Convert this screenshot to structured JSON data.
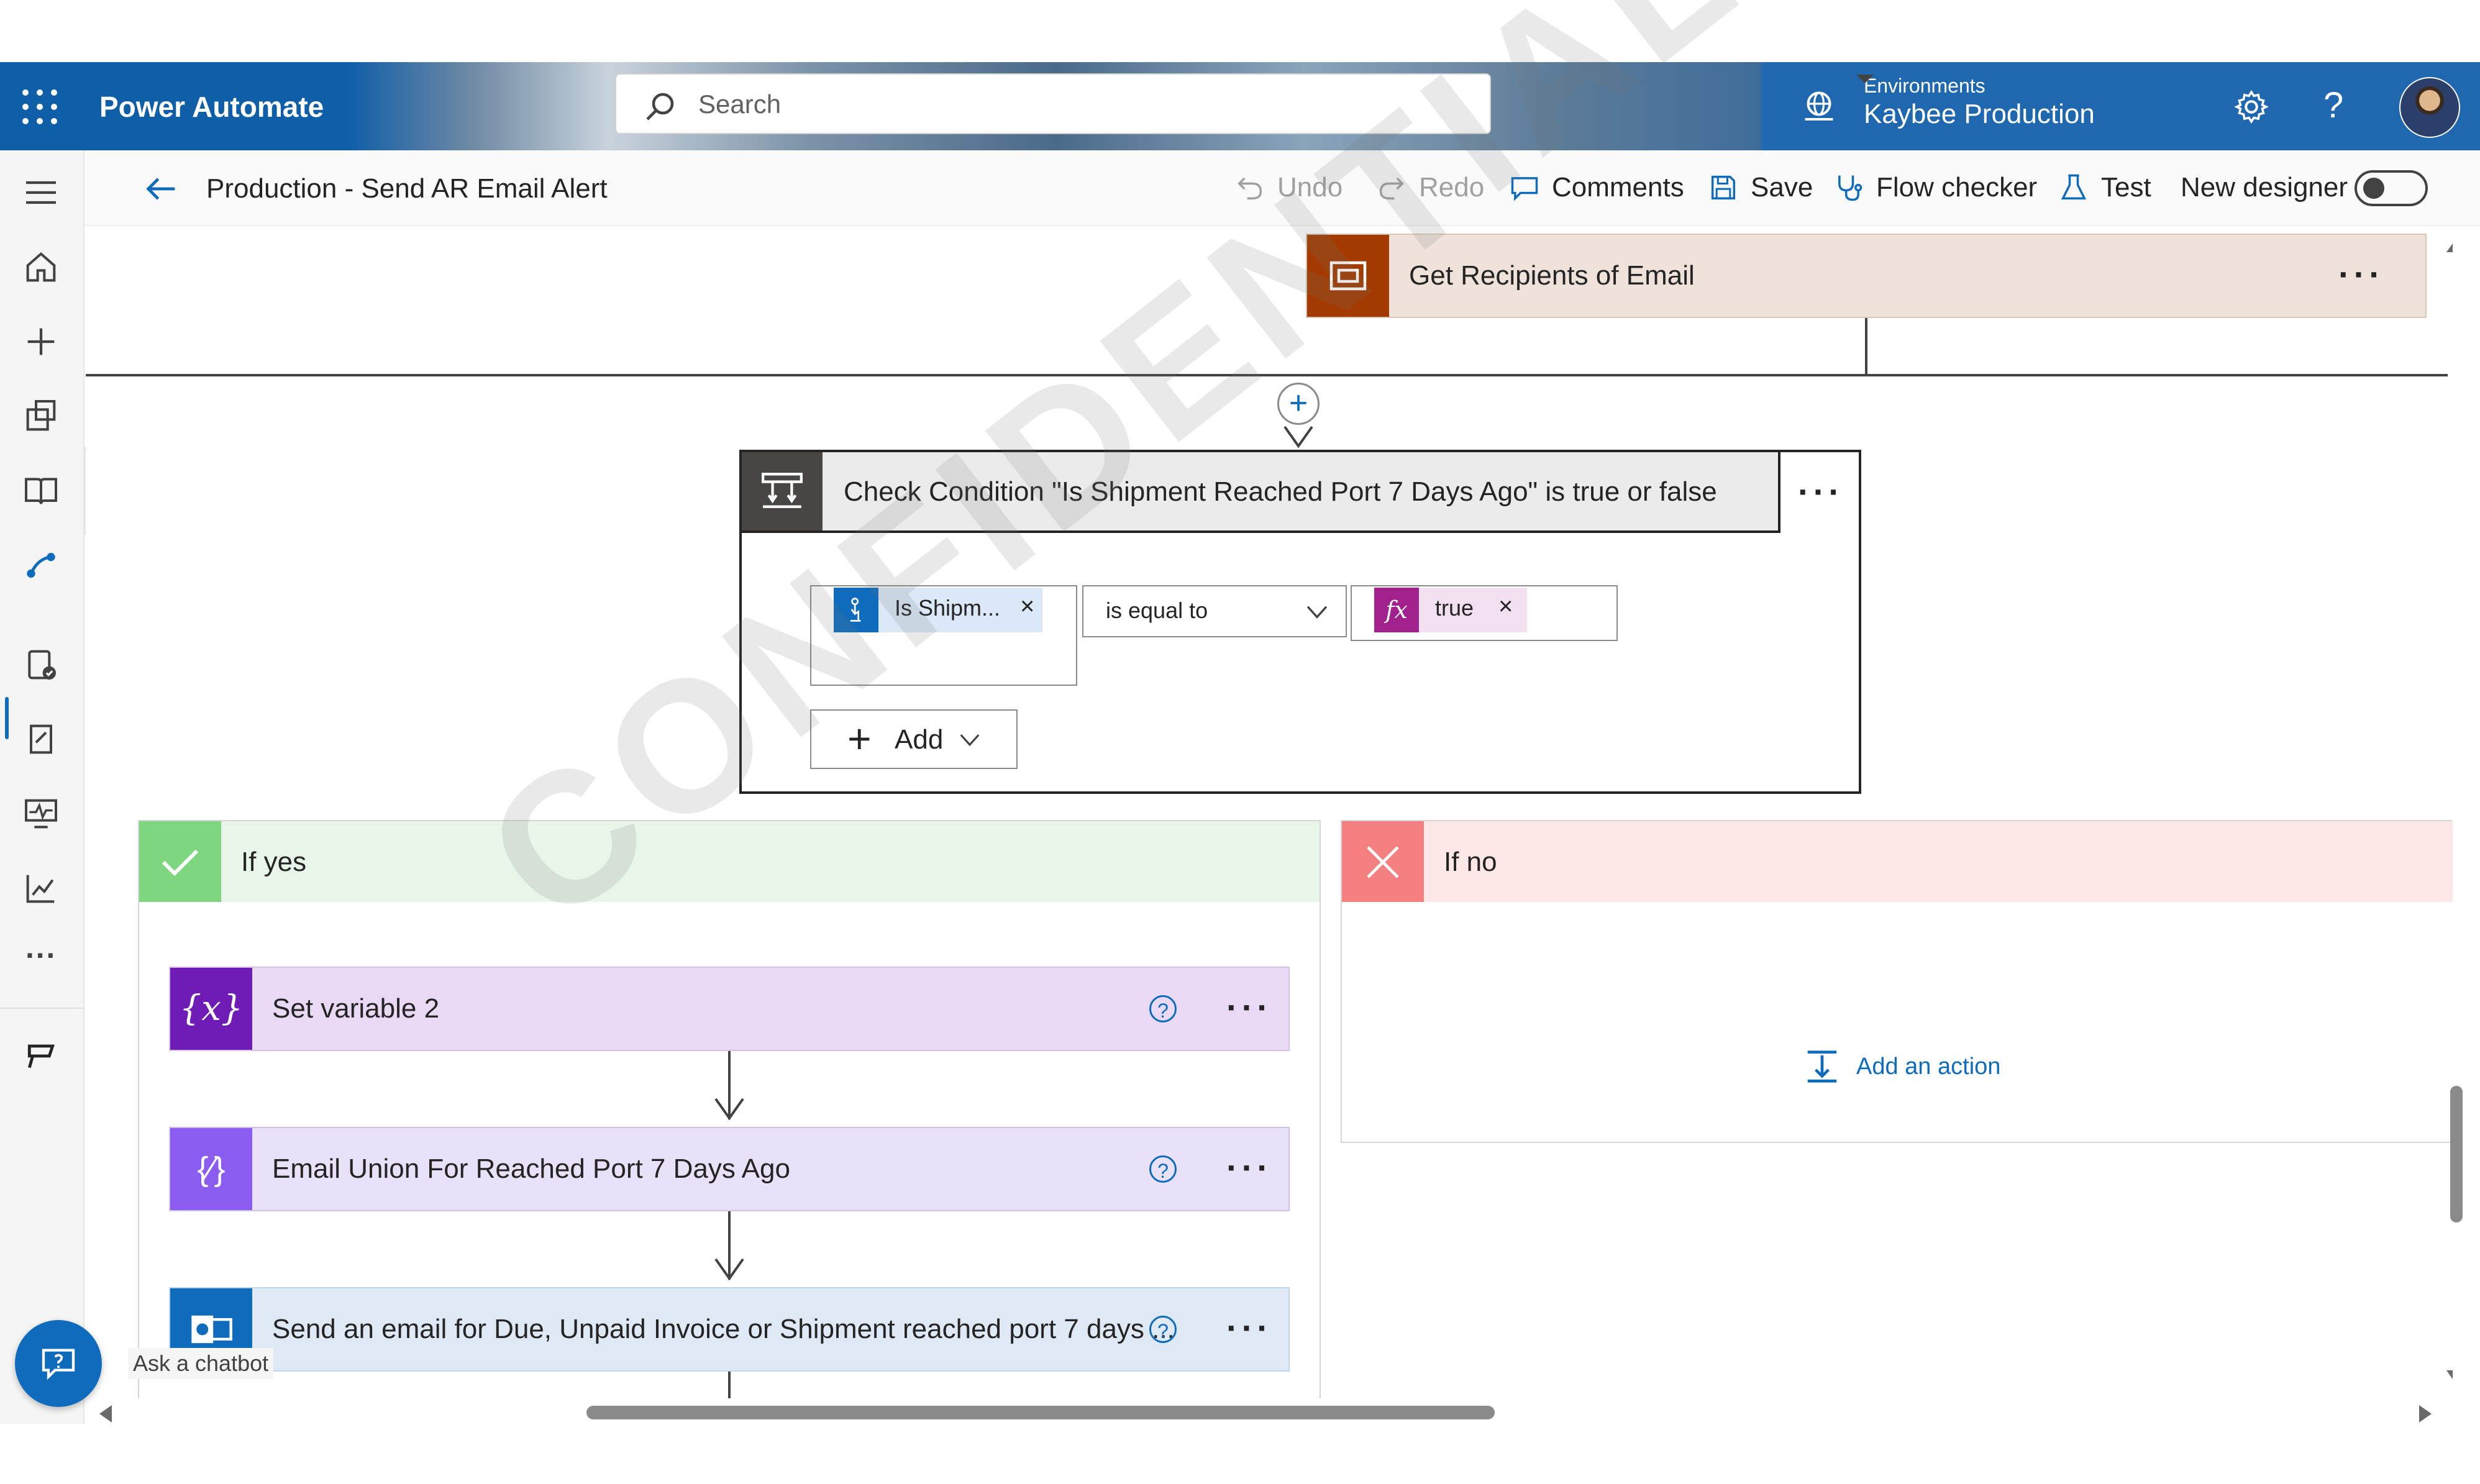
{
  "header": {
    "app_title": "Power Automate",
    "search_placeholder": "Search",
    "environments_label": "Environments",
    "environment_name": "Kaybee Production"
  },
  "command_bar": {
    "flow_name": "Production - Send AR Email Alert",
    "undo": "Undo",
    "redo": "Redo",
    "comments": "Comments",
    "save": "Save",
    "flow_checker": "Flow checker",
    "test": "Test",
    "new_designer": "New designer",
    "new_designer_on": false
  },
  "flow": {
    "get_recipients": "Get Recipients of Email",
    "condition_title": "Check Condition \"Is Shipment Reached Port 7 Days Ago\" is true or false",
    "condition_left_token": "Is Shipm...",
    "condition_operator": "is equal to",
    "condition_right_token": "true",
    "add_button": "Add",
    "if_yes_label": "If yes",
    "if_no_label": "If no",
    "yes_actions": [
      "Set variable 2",
      "Email Union For Reached Port 7 Days Ago",
      "Send an email for Due, Unpaid Invoice or Shipment reached port 7 days ..."
    ],
    "add_an_action": "Add an action"
  },
  "watermark": "CONFIDENTIAL",
  "chatbot_label": "Ask a chatbot",
  "colors": {
    "brand_blue": "#0f6cbd",
    "get_recipients_icon_bg": "#a33b00",
    "get_recipients_card_bg": "#efe2da",
    "condition_icon_bg": "#484644",
    "yes_header_bg": "#e8f5e9",
    "yes_icon_bg": "#7ed67e",
    "no_header_bg": "#fde7e7",
    "no_icon_bg": "#f47f7f",
    "set_variable_bg": "#ead9f5",
    "set_variable_icon": "#6f1bb5",
    "compose_bg": "#e9e1f7",
    "compose_icon": "#8a5cf0",
    "email_bg": "#dfe9f5",
    "email_icon": "#0f6cbd"
  }
}
